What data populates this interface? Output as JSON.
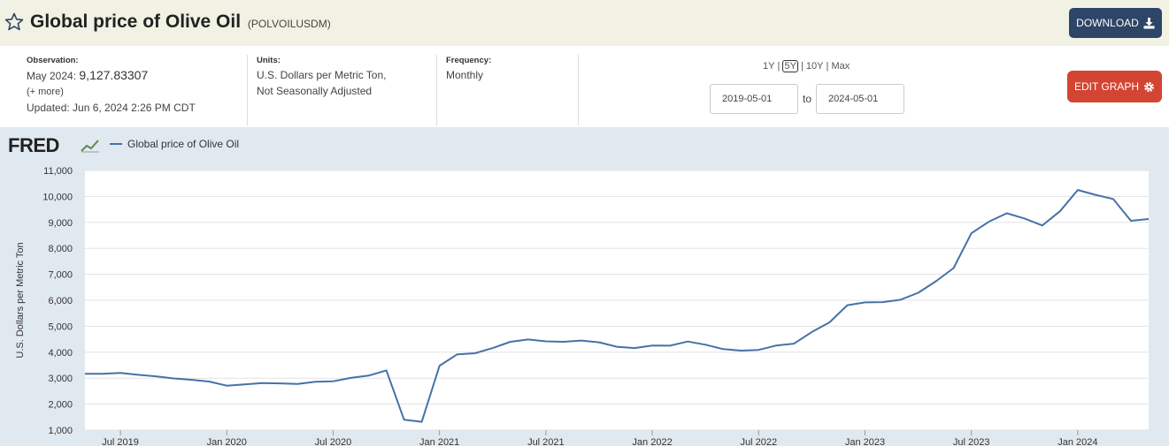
{
  "header": {
    "title": "Global price of Olive Oil",
    "series_id": "(POLVOILUSDM)",
    "download_label": "DOWNLOAD"
  },
  "meta": {
    "observation_label": "Observation:",
    "observation_date": "May 2024:",
    "observation_value": "9,127.83307",
    "more_label": "(+ more)",
    "updated": "Updated: Jun 6, 2024 2:26 PM CDT",
    "units_label": "Units:",
    "units_line1": "U.S. Dollars per Metric Ton,",
    "units_line2": "Not Seasonally Adjusted",
    "frequency_label": "Frequency:",
    "frequency_value": "Monthly"
  },
  "controls": {
    "ranges": [
      "1Y",
      "5Y",
      "10Y",
      "Max"
    ],
    "active_range": "5Y",
    "start_date": "2019-05-01",
    "to_label": "to",
    "end_date": "2024-05-01",
    "edit_label": "EDIT GRAPH"
  },
  "colors": {
    "line": "#4572a7",
    "download": "#2d4566",
    "edit": "#d44432"
  },
  "chart_data": {
    "type": "line",
    "logo": "FRED",
    "ylabel": "U.S. Dollars per Metric Ton",
    "ylim": [
      1000,
      11000
    ],
    "yticks": [
      "1,000",
      "2,000",
      "3,000",
      "4,000",
      "5,000",
      "6,000",
      "7,000",
      "8,000",
      "9,000",
      "10,000",
      "11,000"
    ],
    "xtick_labels": [
      "Jul 2019",
      "Jan 2020",
      "Jul 2020",
      "Jan 2021",
      "Jul 2021",
      "Jan 2022",
      "Jul 2022",
      "Jan 2023",
      "Jul 2023",
      "Jan 2024"
    ],
    "grid": true,
    "legend_position": "top-left",
    "series": [
      {
        "name": "Global price of Olive Oil",
        "x": [
          "2019-05",
          "2019-06",
          "2019-07",
          "2019-08",
          "2019-09",
          "2019-10",
          "2019-11",
          "2019-12",
          "2020-01",
          "2020-02",
          "2020-03",
          "2020-04",
          "2020-05",
          "2020-06",
          "2020-07",
          "2020-08",
          "2020-09",
          "2020-10",
          "2020-11",
          "2020-12",
          "2021-01",
          "2021-02",
          "2021-03",
          "2021-04",
          "2021-05",
          "2021-06",
          "2021-07",
          "2021-08",
          "2021-09",
          "2021-10",
          "2021-11",
          "2021-12",
          "2022-01",
          "2022-02",
          "2022-03",
          "2022-04",
          "2022-05",
          "2022-06",
          "2022-07",
          "2022-08",
          "2022-09",
          "2022-10",
          "2022-11",
          "2022-12",
          "2023-01",
          "2023-02",
          "2023-03",
          "2023-04",
          "2023-05",
          "2023-06",
          "2023-07",
          "2023-08",
          "2023-09",
          "2023-10",
          "2023-11",
          "2023-12",
          "2024-01",
          "2024-02",
          "2024-03",
          "2024-04",
          "2024-05"
        ],
        "values": [
          3170,
          3170,
          3200,
          3130,
          3070,
          2990,
          2940,
          2870,
          2710,
          2760,
          2810,
          2800,
          2780,
          2860,
          2880,
          3010,
          3100,
          3300,
          1400,
          1320,
          3480,
          3920,
          3960,
          4160,
          4400,
          4490,
          4420,
          4400,
          4450,
          4380,
          4210,
          4160,
          4260,
          4250,
          4410,
          4290,
          4120,
          4060,
          4090,
          4260,
          4330,
          4780,
          5150,
          5810,
          5920,
          5930,
          6020,
          6290,
          6730,
          7240,
          8580,
          9030,
          9350,
          9150,
          8880,
          9430,
          10250,
          10060,
          9900,
          9060,
          9130
        ]
      }
    ]
  }
}
